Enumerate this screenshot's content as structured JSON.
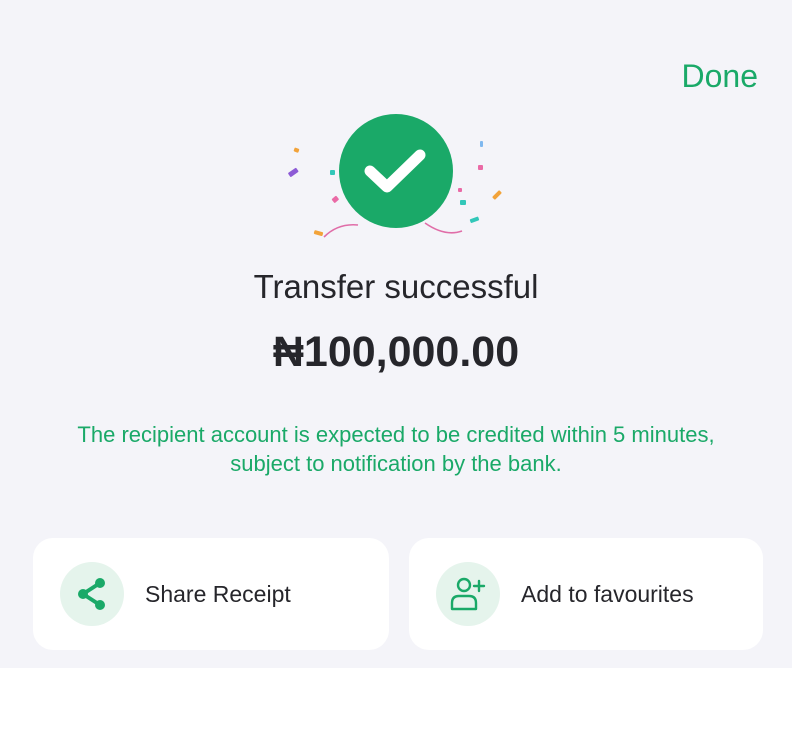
{
  "header": {
    "done_label": "Done"
  },
  "status": {
    "title": "Transfer successful",
    "amount": "₦100,000.00",
    "note": "The recipient account is expected to be credited within 5 minutes, subject to notification by the bank."
  },
  "actions": [
    {
      "label": "Share Receipt",
      "icon": "share-icon"
    },
    {
      "label": "Add to favourites",
      "icon": "add-user-icon"
    }
  ],
  "colors": {
    "accent": "#1aa968",
    "background": "#f4f4f9",
    "card": "#ffffff",
    "text": "#26262b"
  }
}
